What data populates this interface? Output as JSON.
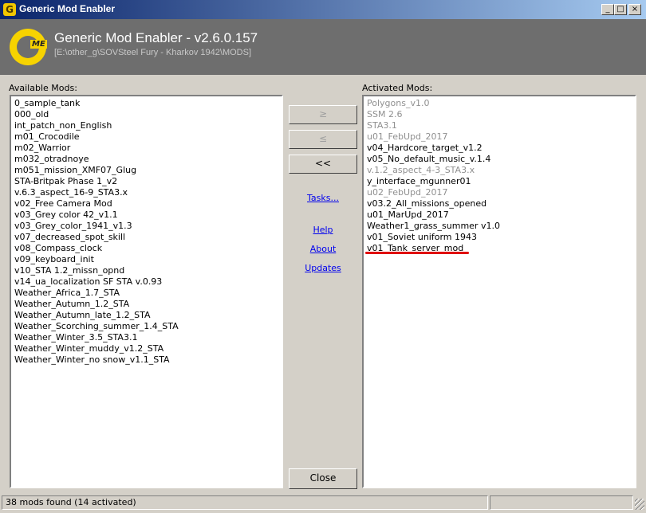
{
  "window": {
    "title": "Generic Mod Enabler",
    "icon_letter": "G",
    "minimize_glyph": "_",
    "maximize_glyph": "□",
    "close_glyph": "×"
  },
  "header": {
    "logo_letter": "G",
    "logo_sub": "ME",
    "title": "Generic Mod Enabler - v2.6.0.157",
    "path": "[E:\\other_g\\SOVSteel Fury - Kharkov 1942\\MODS]"
  },
  "available": {
    "label": "Available Mods:",
    "items": [
      "0_sample_tank",
      "000_old",
      "int_patch_non_English",
      "m01_Crocodile",
      "m02_Warrior",
      "m032_otradnoye",
      "m051_mission_XMF07_Glug",
      "STA-Britpak Phase 1_v2",
      "v.6.3_aspect_16-9_STA3.x",
      "v02_Free Camera Mod",
      "v03_Grey color 42_v1.1",
      "v03_Grey_color_1941_v1.3",
      "v07_decreased_spot_skill",
      "v08_Compass_clock",
      "v09_keyboard_init",
      "v10_STA 1.2_missn_opnd",
      "v14_ua_localization SF STA v.0.93",
      "Weather_Africa_1.7_STA",
      "Weather_Autumn_1.2_STA",
      "Weather_Autumn_late_1.2_STA",
      "Weather_Scorching_summer_1.4_STA",
      "Weather_Winter_3.5_STA3.1",
      "Weather_Winter_muddy_v1.2_STA",
      "Weather_Winter_no snow_v1.1_STA"
    ]
  },
  "activated": {
    "label": "Activated Mods:",
    "items": [
      {
        "name": "Polygons_v1.0",
        "disabled": true
      },
      {
        "name": "SSM 2.6",
        "disabled": true
      },
      {
        "name": "STA3.1",
        "disabled": true
      },
      {
        "name": "u01_FebUpd_2017",
        "disabled": true
      },
      {
        "name": "v04_Hardcore_target_v1.2",
        "disabled": false
      },
      {
        "name": "v05_No_default_music_v.1.4",
        "disabled": false
      },
      {
        "name": "v.1.2_aspect_4-3_STA3.x",
        "disabled": true
      },
      {
        "name": "y_interface_mgunner01",
        "disabled": false
      },
      {
        "name": "u02_FebUpd_2017",
        "disabled": true
      },
      {
        "name": "v03.2_All_missions_opened",
        "disabled": false
      },
      {
        "name": "u01_MarUpd_2017",
        "disabled": false
      },
      {
        "name": "Weather1_grass_summer v1.0",
        "disabled": false
      },
      {
        "name": "v01_Soviet uniform 1943",
        "disabled": false
      },
      {
        "name": "v01_Tank_server_mod",
        "disabled": false
      }
    ]
  },
  "buttons": {
    "activate": "≥",
    "deactivate": "≤",
    "deactivate_all": "<<",
    "close": "Close"
  },
  "links": {
    "tasks": "Tasks...",
    "help": "Help",
    "about": "About",
    "updates": "Updates"
  },
  "status": {
    "text": "38 mods found (14 activated)"
  },
  "colors": {
    "titlebar_start": "#0a246a",
    "titlebar_end": "#a6caf0",
    "logo_yellow": "#f7d300",
    "annotation_red": "#e00000",
    "disabled_text": "#909090"
  }
}
